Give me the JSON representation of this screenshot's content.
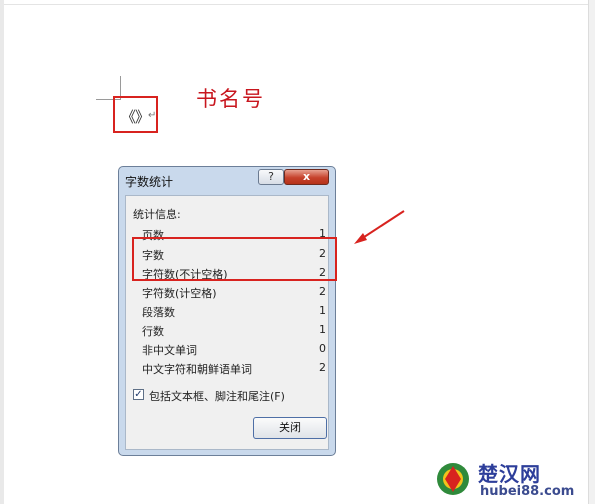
{
  "document": {
    "symbol_text": "《》",
    "heading": "书名号"
  },
  "dialog": {
    "title": "字数统计",
    "help_label": "?",
    "close_x_label": "x",
    "section_label": "统计信息:",
    "stats": [
      {
        "label": "页数",
        "value": "1"
      },
      {
        "label": "字数",
        "value": "2"
      },
      {
        "label": "字符数(不计空格)",
        "value": "2"
      },
      {
        "label": "字符数(计空格)",
        "value": "2"
      },
      {
        "label": "段落数",
        "value": "1"
      },
      {
        "label": "行数",
        "value": "1"
      },
      {
        "label": "非中文单词",
        "value": "0"
      },
      {
        "label": "中文字符和朝鲜语单词",
        "value": "2"
      }
    ],
    "checkbox_label": "包括文本框、脚注和尾注(F)",
    "checkbox_checked": true,
    "close_button_label": "关闭"
  },
  "watermark": {
    "title": "楚汉网",
    "url": "hubei88.com"
  },
  "colors": {
    "annotation_red": "#d8231f",
    "heading_red": "#c8161e",
    "dialog_frame": "#c9d9ec"
  }
}
